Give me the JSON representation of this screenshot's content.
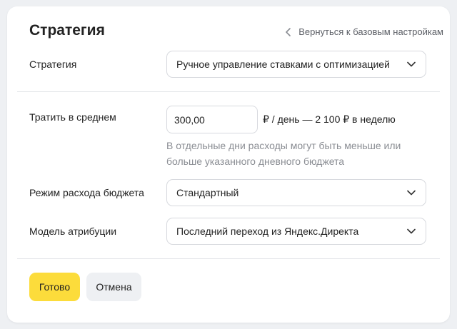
{
  "header": {
    "title": "Стратегия",
    "back_link": "Вернуться к базовым настройкам"
  },
  "strategy": {
    "label": "Стратегия",
    "value": "Ручное управление ставками с оптимизацией"
  },
  "budget": {
    "label": "Тратить в среднем",
    "amount": "300,00",
    "per_day_text": "₽ / день — 2 100 ₽ в неделю",
    "hint": "В отдельные дни расходы могут быть меньше или больше указанного дневного бюджета"
  },
  "spend_mode": {
    "label": "Режим расхода бюджета",
    "value": "Стандартный"
  },
  "attribution": {
    "label": "Модель атрибуции",
    "value": "Последний переход из Яндекс.Директа"
  },
  "actions": {
    "done": "Готово",
    "cancel": "Отмена"
  },
  "icons": {
    "back": "chevron-left-icon",
    "dropdown": "chevron-down-icon"
  },
  "colors": {
    "primary_button": "#fcdc3b",
    "secondary_button": "#eef0f3",
    "hint_text": "#8a8d93"
  }
}
